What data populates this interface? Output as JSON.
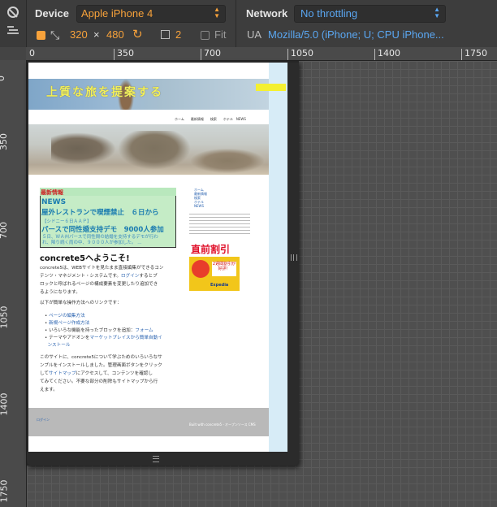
{
  "toolbar": {
    "device_label": "Device",
    "device_value": "Apple iPhone 4",
    "network_label": "Network",
    "network_value": "No throttling",
    "width": "320",
    "times": "×",
    "height": "480",
    "scale": "2",
    "fit_label": "Fit",
    "ua_label": "UA",
    "ua_value": "Mozilla/5.0 (iPhone; U; CPU iPhone..."
  },
  "ruler": {
    "top": [
      "0",
      "350",
      "700",
      "1050",
      "1400",
      "1750"
    ],
    "left": [
      "0",
      "350",
      "700",
      "1050",
      "1400",
      "1750"
    ]
  },
  "page": {
    "header_title": "上質な旅を提案する",
    "header_tag": "",
    "nav": "ホーム　　最新情報　　検索　　ホテル　NEWS",
    "news_heading": "最新情報",
    "news_title": "NEWS",
    "news_item1": "屋外レストランで喫煙禁止　６日から",
    "news_item1_sub": "【シドニー６日ＡＡＰ】",
    "news_item2": "パースで同性婚支持デモ　9000人参加",
    "news_item2_sub": "５日、ＷＡ州パースで同性間の結婚を支持するデモが行われ、降り続く雨の中、９０００人が参加した。 ...",
    "welcome": "concrete5へようこそ!",
    "para1_a": "concrete5は、WEBサイトを見たまま直接編集ができるコン",
    "para1_b": "テンツ・マネジメント・システムです。",
    "para1_login": "ログイン",
    "para1_c": "するとブ",
    "para1_d": "ロックと呼ばれるページの構成要素を変更したり追加でき",
    "para1_e": "るようになります。",
    "para2": "以下が簡単な操作方法へのリンクです：",
    "bullet1": "ページの編集方法",
    "bullet2": "新規ページ作成方法",
    "bullet3_a": "いろいろな機能を持ったブロックを追加：",
    "bullet3_link": "フォーム",
    "bullet4_a": "テーマやアドオンを",
    "bullet4_link": "マーケットプレイスから簡単自動イ",
    "bullet4_b": "ンストール",
    "para3_a": "このサイトに、concrete5について学ぶためのいろいろなサ",
    "para3_b": "ンプルをインストールしました。管理画面ボタンをクリック",
    "para3_c": "して",
    "para3_link": "サイトマップ",
    "para3_d": "にアクセスして、コンテンツを確認し",
    "para3_e": "てみてください。不要な部分の削除もサイトマップから行",
    "para3_f": "えます。",
    "side_links": [
      "ホーム",
      "最新情報",
      "検索",
      "ホテル",
      "NEWS"
    ],
    "ad_title": "直前割引",
    "ad_sub": "2週間割引が好評！",
    "ad_brand": "Expedia",
    "footer_login": "ログイン",
    "footer_left": "",
    "footer_right": "Built with concrete5 - オープンソース CMS"
  },
  "colors": {
    "accent": "#f7a23b",
    "link": "#5aa7f2"
  }
}
